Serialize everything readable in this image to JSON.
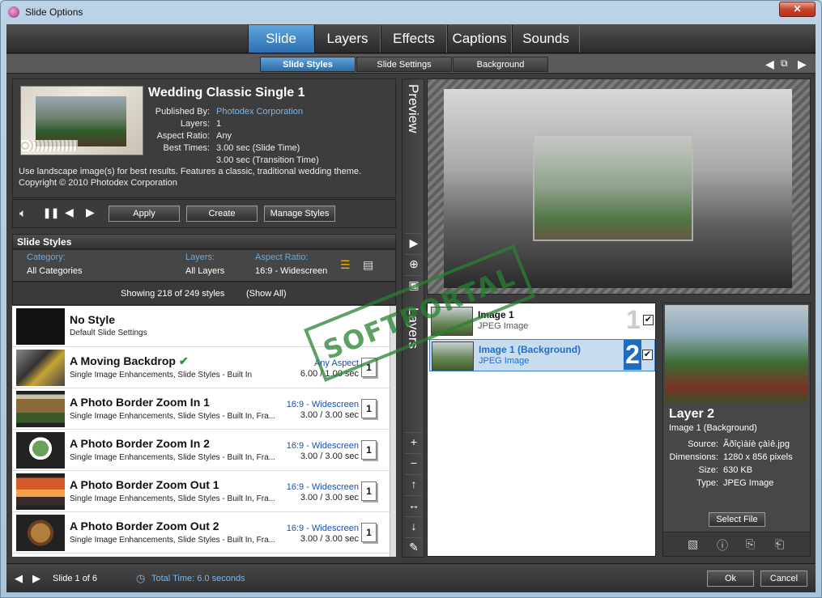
{
  "window": {
    "title": "Slide Options",
    "close": "✕"
  },
  "top_tabs": [
    "Slide",
    "Layers",
    "Effects",
    "Captions",
    "Sounds"
  ],
  "sub_tabs": [
    "Slide Styles",
    "Slide Settings",
    "Background"
  ],
  "style_info": {
    "title": "Wedding Classic Single 1",
    "published_by_label": "Published By:",
    "published_by": "Photodex Corporation",
    "layers_label": "Layers:",
    "layers": "1",
    "aspect_label": "Aspect Ratio:",
    "aspect": "Any",
    "best_times_label": "Best Times:",
    "slide_time": "3.00 sec (Slide Time)",
    "transition_time": "3.00 sec (Transition Time)",
    "description": "Use landscape image(s) for best results. Features a classic, traditional wedding theme.",
    "copyright": "Copyright © 2010 Photodex Corporation"
  },
  "controls": {
    "apply": "Apply",
    "create": "Create",
    "manage": "Manage Styles"
  },
  "slide_styles": {
    "heading": "Slide Styles",
    "category_label": "Category:",
    "category": "All Categories",
    "layers_label": "Layers:",
    "layers": "All Layers",
    "aspect_label": "Aspect Ratio:",
    "aspect": "16:9 - Widescreen",
    "showing": "Showing 218 of 249 styles",
    "show_all": "(Show All)"
  },
  "styles": [
    {
      "name": "No Style",
      "desc": "Default Slide Settings",
      "aspect": "",
      "time": "",
      "count": ""
    },
    {
      "name": "A Moving Backdrop",
      "desc": "Single Image Enhancements, Slide Styles - Built In",
      "aspect": "Any Aspect",
      "time": "6.00 / 1.00 sec",
      "count": "1"
    },
    {
      "name": "A Photo Border Zoom In 1",
      "desc": "Single Image Enhancements, Slide Styles - Built In, Fra...",
      "aspect": "16:9 - Widescreen",
      "time": "3.00 / 3.00 sec",
      "count": "1"
    },
    {
      "name": "A Photo Border Zoom In 2",
      "desc": "Single Image Enhancements, Slide Styles - Built In, Fra...",
      "aspect": "16:9 - Widescreen",
      "time": "3.00 / 3.00 sec",
      "count": "1"
    },
    {
      "name": "A Photo Border Zoom Out 1",
      "desc": "Single Image Enhancements, Slide Styles - Built In, Fra...",
      "aspect": "16:9 - Widescreen",
      "time": "3.00 / 3.00 sec",
      "count": "1"
    },
    {
      "name": "A Photo Border Zoom Out 2",
      "desc": "Single Image Enhancements, Slide Styles - Built In, Fra...",
      "aspect": "16:9 - Widescreen",
      "time": "3.00 / 3.00 sec",
      "count": "1"
    }
  ],
  "vertical_tabs": {
    "preview": "Preview",
    "layers": "Layers"
  },
  "layers": [
    {
      "name": "Image 1",
      "type": "JPEG Image",
      "num": "1"
    },
    {
      "name": "Image 1 (Background)",
      "type": "JPEG Image",
      "num": "2"
    }
  ],
  "layer_info": {
    "title": "Layer 2",
    "subtitle": "Image 1 (Background)",
    "source_label": "Source:",
    "source": "Ãðîçìàíè çàìê.jpg",
    "dimensions_label": "Dimensions:",
    "dimensions": "1280 x 856 pixels",
    "size_label": "Size:",
    "size": "630 KB",
    "type_label": "Type:",
    "type": "JPEG Image",
    "select_file": "Select File"
  },
  "footer": {
    "slide": "Slide 1 of 6",
    "total_time": "Total Time: 6.0 seconds",
    "ok": "Ok",
    "cancel": "Cancel"
  },
  "watermark": "SOFTPORTAL",
  "colors": {
    "accent": "#2f6fb0",
    "link": "#7ab6ec"
  }
}
